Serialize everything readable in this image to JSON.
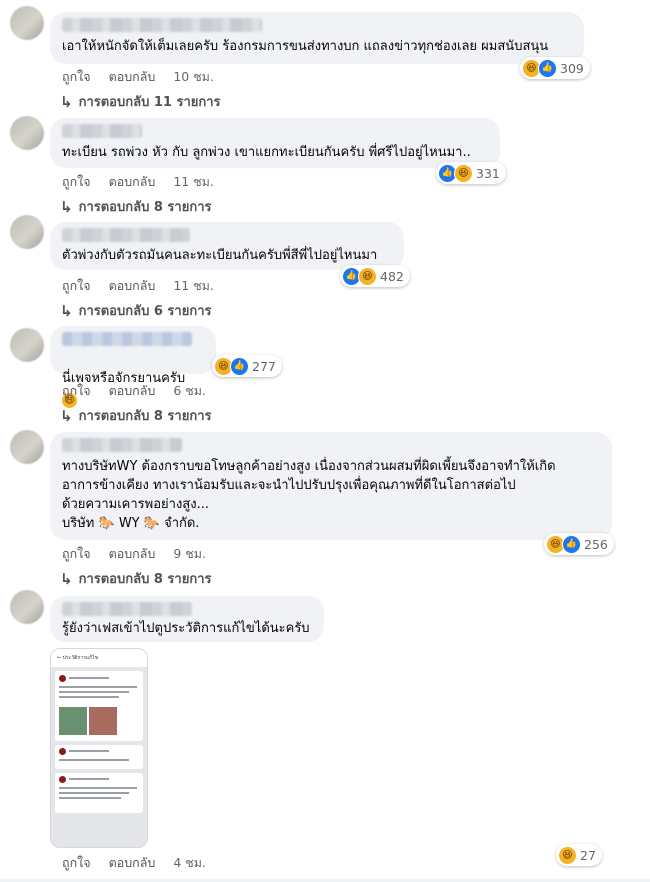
{
  "comments": [
    {
      "text": "เอาให้หนักจัดให้เต็มเลยครับ ร้องกรมการขนส่งทางบก แถลงข่าวทุกช่องเลย ผมสนับสนุน",
      "like": "ถูกใจ",
      "reply": "ตอบกลับ",
      "time": "10 ชม.",
      "replies": "การตอบกลับ 11 รายการ",
      "reaction_count": "309"
    },
    {
      "text": "ทะเบียน รถพ่วง หัว กับ ลูกพ่วง เขาแยกทะเบียนกันครับ พี่ศรีไปอยู่ไหนมา..",
      "like": "ถูกใจ",
      "reply": "ตอบกลับ",
      "time": "11 ชม.",
      "replies": "การตอบกลับ 8 รายการ",
      "reaction_count": "331"
    },
    {
      "text": "ตัวพ่วงกับตัวรถมันคนละทะเบียนกันครับพี่สีพี่ไปอยู่ไหนมา",
      "like": "ถูกใจ",
      "reply": "ตอบกลับ",
      "time": "11 ชม.",
      "replies": "การตอบกลับ 6 รายการ",
      "reaction_count": "482"
    },
    {
      "text": "นี่เพจหรือจักรยานครับ",
      "like": "ถูกใจ",
      "reply": "ตอบกลับ",
      "time": "6 ชม.",
      "replies": "การตอบกลับ 8 รายการ",
      "reaction_count": "277"
    },
    {
      "text": "ทางบริษัทWY ต้องกราบขอโทษลูกค้าอย่างสูง เนื่องจากส่วนผสมที่ผิดเพี้ยนจึงอาจทำให้เกิด\nอาการข้างเคียง ทางเราน้อมรับและจะนำไปปรับปรุงเพื่อคุณภาพที่ดีในโอกาสต่อไป\nด้วยความเคารพอย่างสูง...\nบริษัท 🐎 WY 🐎 จำกัด.",
      "like": "ถูกใจ",
      "reply": "ตอบกลับ",
      "time": "9 ชม.",
      "replies": "การตอบกลับ 8 รายการ",
      "reaction_count": "256"
    },
    {
      "text": "รู้ยังว่าเฟสเข้าไปตูประวัติการแก้ไขได้นะครับ",
      "like": "ถูกใจ",
      "reply": "ตอบกลับ",
      "time": "4 ชม.",
      "reaction_count": "27"
    }
  ],
  "screenshot_header": "ประวัติการแก้ไข",
  "icons": {
    "reply_arrow": "reply-arrow-icon",
    "haha": "haha-reaction-icon",
    "like": "like-reaction-icon",
    "emoji": "grinning-emoji-icon"
  },
  "colors": {
    "bubble": "#f0f2f5",
    "like_blue": "#1877f2",
    "haha_yellow": "#f7b125"
  }
}
